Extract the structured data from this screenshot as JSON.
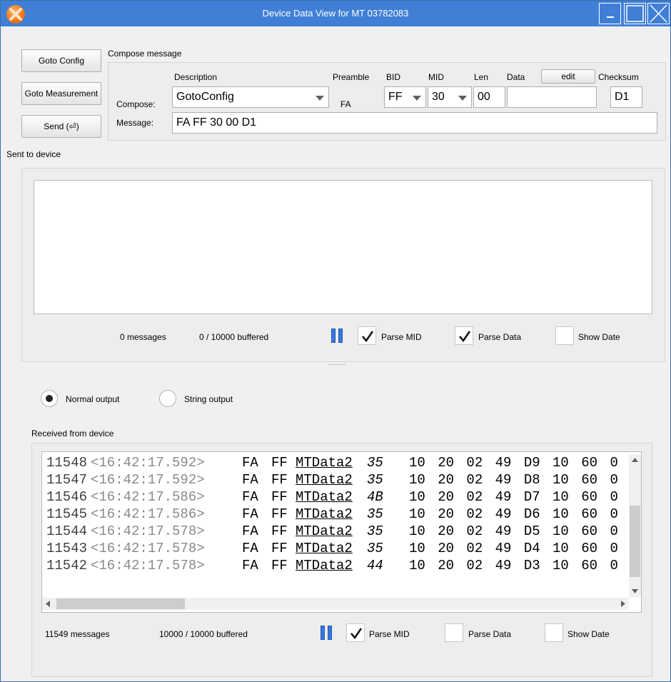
{
  "window": {
    "title": "Device Data View for MT 03782083",
    "accent_color": "#3f7fd6"
  },
  "side_buttons": {
    "goto_config": "Goto Config",
    "goto_measurement": "Goto Measurement",
    "send": "Send (⏎)"
  },
  "compose": {
    "group_title": "Compose message",
    "headers": {
      "description": "Description",
      "preamble": "Preamble",
      "bid": "BID",
      "mid": "MID",
      "len": "Len",
      "data": "Data",
      "checksum": "Checksum"
    },
    "edit_button": "edit",
    "compose_label": "Compose:",
    "message_label": "Message:",
    "description_value": "GotoConfig",
    "preamble_value": "FA",
    "bid_value": "FF",
    "mid_value": "30",
    "len_value": "00",
    "data_value": "",
    "checksum_value": "D1",
    "message_value": "FA FF 30 00 D1"
  },
  "sent": {
    "title": "Sent to device",
    "messages": "0 messages",
    "buffered": "0 / 10000 buffered",
    "parse_mid_label": "Parse MID",
    "parse_mid_checked": true,
    "parse_data_label": "Parse Data",
    "parse_data_checked": true,
    "show_date_label": "Show Date",
    "show_date_checked": false
  },
  "output_mode": {
    "normal_label": "Normal output",
    "string_label": "String output",
    "selected": "normal"
  },
  "received": {
    "title": "Received from device",
    "rows": [
      {
        "idx": "11548",
        "ts": "<16:42:17.592>",
        "pre": "FA",
        "bid": "FF",
        "mid": "MTData2",
        "len": "35",
        "data": "10 20 02 49 D9 10 60 0"
      },
      {
        "idx": "11547",
        "ts": "<16:42:17.592>",
        "pre": "FA",
        "bid": "FF",
        "mid": "MTData2",
        "len": "35",
        "data": "10 20 02 49 D8 10 60 0"
      },
      {
        "idx": "11546",
        "ts": "<16:42:17.586>",
        "pre": "FA",
        "bid": "FF",
        "mid": "MTData2",
        "len": "4B",
        "data": "10 20 02 49 D7 10 60 0"
      },
      {
        "idx": "11545",
        "ts": "<16:42:17.586>",
        "pre": "FA",
        "bid": "FF",
        "mid": "MTData2",
        "len": "35",
        "data": "10 20 02 49 D6 10 60 0"
      },
      {
        "idx": "11544",
        "ts": "<16:42:17.578>",
        "pre": "FA",
        "bid": "FF",
        "mid": "MTData2",
        "len": "35",
        "data": "10 20 02 49 D5 10 60 0"
      },
      {
        "idx": "11543",
        "ts": "<16:42:17.578>",
        "pre": "FA",
        "bid": "FF",
        "mid": "MTData2",
        "len": "35",
        "data": "10 20 02 49 D4 10 60 0"
      },
      {
        "idx": "11542",
        "ts": "<16:42:17.578>",
        "pre": "FA",
        "bid": "FF",
        "mid": "MTData2",
        "len": "44",
        "data": "10 20 02 49 D3 10 60 0"
      }
    ],
    "messages": "11549 messages",
    "buffered": "10000 / 10000 buffered",
    "parse_mid_label": "Parse MID",
    "parse_mid_checked": true,
    "parse_data_label": "Parse Data",
    "parse_data_checked": false,
    "show_date_label": "Show Date",
    "show_date_checked": false
  }
}
